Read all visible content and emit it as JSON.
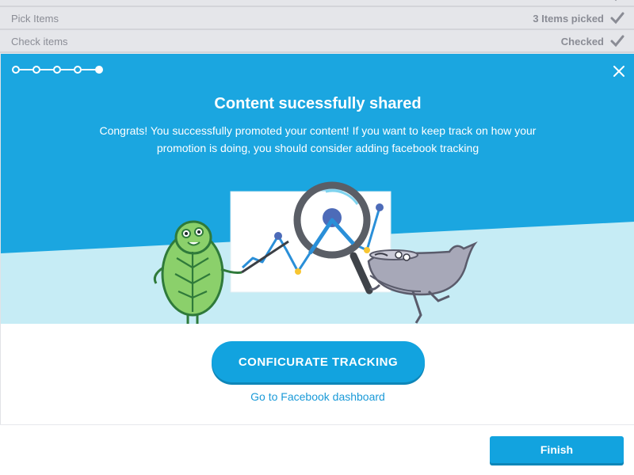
{
  "background_list": {
    "rows": [
      {
        "label": "Pick Items",
        "status": "3 Items picked"
      },
      {
        "label": "Check items",
        "status": "Checked"
      }
    ]
  },
  "modal": {
    "stepper": {
      "total_steps": 5,
      "current_step": 5
    },
    "close_icon": "close-icon",
    "title": "Content sucessfully shared",
    "description": "Congrats! You successfully promoted your content! If you want to keep track on how your promotion is doing, you should consider adding facebook tracking",
    "primary_button": "CONFICURATE TRACKING",
    "secondary_link": "Go to Facebook dashboard"
  },
  "footer": {
    "finish_button": "Finish"
  },
  "colors": {
    "accent": "#12a3df",
    "hero_bg": "#1ba6e0",
    "hero_floor": "#c6ecf5",
    "leaf_green": "#8bd06b",
    "whale_gray": "#a7a8b8"
  }
}
